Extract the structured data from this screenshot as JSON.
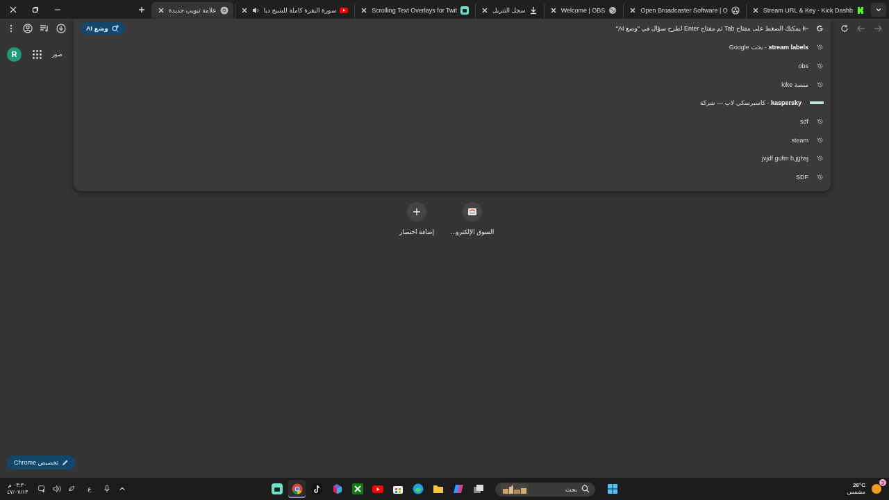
{
  "tabs": [
    {
      "title": "Stream URL & Key - Kick Dashb",
      "kind": "kick",
      "selected": false
    },
    {
      "title": "Open Broadcaster Software | O",
      "kind": "obs",
      "selected": false
    },
    {
      "title": "Welcome | OBS",
      "kind": "globe",
      "selected": false
    },
    {
      "title": "سجل التنزيل",
      "kind": "download",
      "selected": false
    },
    {
      "title": "Scrolling Text Overlays for Twit",
      "kind": "app",
      "selected": false
    },
    {
      "title": "سورة البقرة كاملة للشيخ دبا",
      "kind": "youtube",
      "selected": false,
      "audio": true
    },
    {
      "title": "علامة تبويب جديدة",
      "kind": "chrome",
      "selected": true
    }
  ],
  "omnibox": {
    "hint": "يمكنك الضغط على مفتاح Tab ثم مفتاح Enter لطرح سؤال في \"وضع AI\"",
    "ai_button": "وضع AI"
  },
  "suggestions": [
    {
      "kind": "history",
      "text": "**stream labels** - بحث Google"
    },
    {
      "kind": "history",
      "text": "obs"
    },
    {
      "kind": "history",
      "text": "منصة kike"
    },
    {
      "kind": "entity",
      "text": "**kaspersky** - كاسبرسكي لاب — شركة"
    },
    {
      "kind": "history",
      "text": "sdf"
    },
    {
      "kind": "history",
      "text": "steam"
    },
    {
      "kind": "history",
      "text": "jvjdf gufm h,jghsj"
    },
    {
      "kind": "history",
      "text": "SDF"
    }
  ],
  "page": {
    "avatar": "R",
    "images_link": "صور",
    "shortcuts": [
      {
        "kind": "site",
        "label": "السوق الإلكترو..."
      },
      {
        "kind": "add",
        "label": "إضافة اختصار"
      }
    ],
    "customize_button": "تخصيص Chrome"
  },
  "taskbar": {
    "weather": {
      "temp": "26°C",
      "condition": "مشمس",
      "badge": "3"
    },
    "search_placeholder": "بحث",
    "apps": [
      {
        "kind": "green-app",
        "active": false
      },
      {
        "kind": "chrome",
        "active": true
      },
      {
        "kind": "tiktok",
        "active": false
      },
      {
        "kind": "office",
        "active": false
      },
      {
        "kind": "xbox",
        "active": false
      },
      {
        "kind": "youtube",
        "active": false
      },
      {
        "kind": "store",
        "active": false
      },
      {
        "kind": "edge",
        "active": false
      },
      {
        "kind": "folder",
        "active": false
      },
      {
        "kind": "copilot",
        "active": false
      },
      {
        "kind": "taskview",
        "active": false
      }
    ],
    "language": "ع",
    "time": "٠٣:٣٠ م",
    "date": "٤٧/٠٧/١٣"
  }
}
